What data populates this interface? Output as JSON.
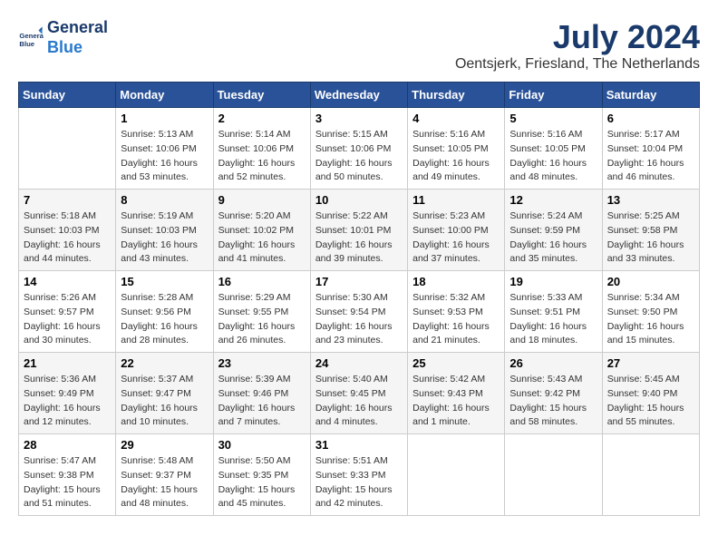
{
  "logo": {
    "line1": "General",
    "line2": "Blue"
  },
  "title": "July 2024",
  "subtitle": "Oentsjerk, Friesland, The Netherlands",
  "headers": [
    "Sunday",
    "Monday",
    "Tuesday",
    "Wednesday",
    "Thursday",
    "Friday",
    "Saturday"
  ],
  "weeks": [
    [
      {
        "day": "",
        "info": ""
      },
      {
        "day": "1",
        "info": "Sunrise: 5:13 AM\nSunset: 10:06 PM\nDaylight: 16 hours\nand 53 minutes."
      },
      {
        "day": "2",
        "info": "Sunrise: 5:14 AM\nSunset: 10:06 PM\nDaylight: 16 hours\nand 52 minutes."
      },
      {
        "day": "3",
        "info": "Sunrise: 5:15 AM\nSunset: 10:06 PM\nDaylight: 16 hours\nand 50 minutes."
      },
      {
        "day": "4",
        "info": "Sunrise: 5:16 AM\nSunset: 10:05 PM\nDaylight: 16 hours\nand 49 minutes."
      },
      {
        "day": "5",
        "info": "Sunrise: 5:16 AM\nSunset: 10:05 PM\nDaylight: 16 hours\nand 48 minutes."
      },
      {
        "day": "6",
        "info": "Sunrise: 5:17 AM\nSunset: 10:04 PM\nDaylight: 16 hours\nand 46 minutes."
      }
    ],
    [
      {
        "day": "7",
        "info": "Sunrise: 5:18 AM\nSunset: 10:03 PM\nDaylight: 16 hours\nand 44 minutes."
      },
      {
        "day": "8",
        "info": "Sunrise: 5:19 AM\nSunset: 10:03 PM\nDaylight: 16 hours\nand 43 minutes."
      },
      {
        "day": "9",
        "info": "Sunrise: 5:20 AM\nSunset: 10:02 PM\nDaylight: 16 hours\nand 41 minutes."
      },
      {
        "day": "10",
        "info": "Sunrise: 5:22 AM\nSunset: 10:01 PM\nDaylight: 16 hours\nand 39 minutes."
      },
      {
        "day": "11",
        "info": "Sunrise: 5:23 AM\nSunset: 10:00 PM\nDaylight: 16 hours\nand 37 minutes."
      },
      {
        "day": "12",
        "info": "Sunrise: 5:24 AM\nSunset: 9:59 PM\nDaylight: 16 hours\nand 35 minutes."
      },
      {
        "day": "13",
        "info": "Sunrise: 5:25 AM\nSunset: 9:58 PM\nDaylight: 16 hours\nand 33 minutes."
      }
    ],
    [
      {
        "day": "14",
        "info": "Sunrise: 5:26 AM\nSunset: 9:57 PM\nDaylight: 16 hours\nand 30 minutes."
      },
      {
        "day": "15",
        "info": "Sunrise: 5:28 AM\nSunset: 9:56 PM\nDaylight: 16 hours\nand 28 minutes."
      },
      {
        "day": "16",
        "info": "Sunrise: 5:29 AM\nSunset: 9:55 PM\nDaylight: 16 hours\nand 26 minutes."
      },
      {
        "day": "17",
        "info": "Sunrise: 5:30 AM\nSunset: 9:54 PM\nDaylight: 16 hours\nand 23 minutes."
      },
      {
        "day": "18",
        "info": "Sunrise: 5:32 AM\nSunset: 9:53 PM\nDaylight: 16 hours\nand 21 minutes."
      },
      {
        "day": "19",
        "info": "Sunrise: 5:33 AM\nSunset: 9:51 PM\nDaylight: 16 hours\nand 18 minutes."
      },
      {
        "day": "20",
        "info": "Sunrise: 5:34 AM\nSunset: 9:50 PM\nDaylight: 16 hours\nand 15 minutes."
      }
    ],
    [
      {
        "day": "21",
        "info": "Sunrise: 5:36 AM\nSunset: 9:49 PM\nDaylight: 16 hours\nand 12 minutes."
      },
      {
        "day": "22",
        "info": "Sunrise: 5:37 AM\nSunset: 9:47 PM\nDaylight: 16 hours\nand 10 minutes."
      },
      {
        "day": "23",
        "info": "Sunrise: 5:39 AM\nSunset: 9:46 PM\nDaylight: 16 hours\nand 7 minutes."
      },
      {
        "day": "24",
        "info": "Sunrise: 5:40 AM\nSunset: 9:45 PM\nDaylight: 16 hours\nand 4 minutes."
      },
      {
        "day": "25",
        "info": "Sunrise: 5:42 AM\nSunset: 9:43 PM\nDaylight: 16 hours\nand 1 minute."
      },
      {
        "day": "26",
        "info": "Sunrise: 5:43 AM\nSunset: 9:42 PM\nDaylight: 15 hours\nand 58 minutes."
      },
      {
        "day": "27",
        "info": "Sunrise: 5:45 AM\nSunset: 9:40 PM\nDaylight: 15 hours\nand 55 minutes."
      }
    ],
    [
      {
        "day": "28",
        "info": "Sunrise: 5:47 AM\nSunset: 9:38 PM\nDaylight: 15 hours\nand 51 minutes."
      },
      {
        "day": "29",
        "info": "Sunrise: 5:48 AM\nSunset: 9:37 PM\nDaylight: 15 hours\nand 48 minutes."
      },
      {
        "day": "30",
        "info": "Sunrise: 5:50 AM\nSunset: 9:35 PM\nDaylight: 15 hours\nand 45 minutes."
      },
      {
        "day": "31",
        "info": "Sunrise: 5:51 AM\nSunset: 9:33 PM\nDaylight: 15 hours\nand 42 minutes."
      },
      {
        "day": "",
        "info": ""
      },
      {
        "day": "",
        "info": ""
      },
      {
        "day": "",
        "info": ""
      }
    ]
  ]
}
